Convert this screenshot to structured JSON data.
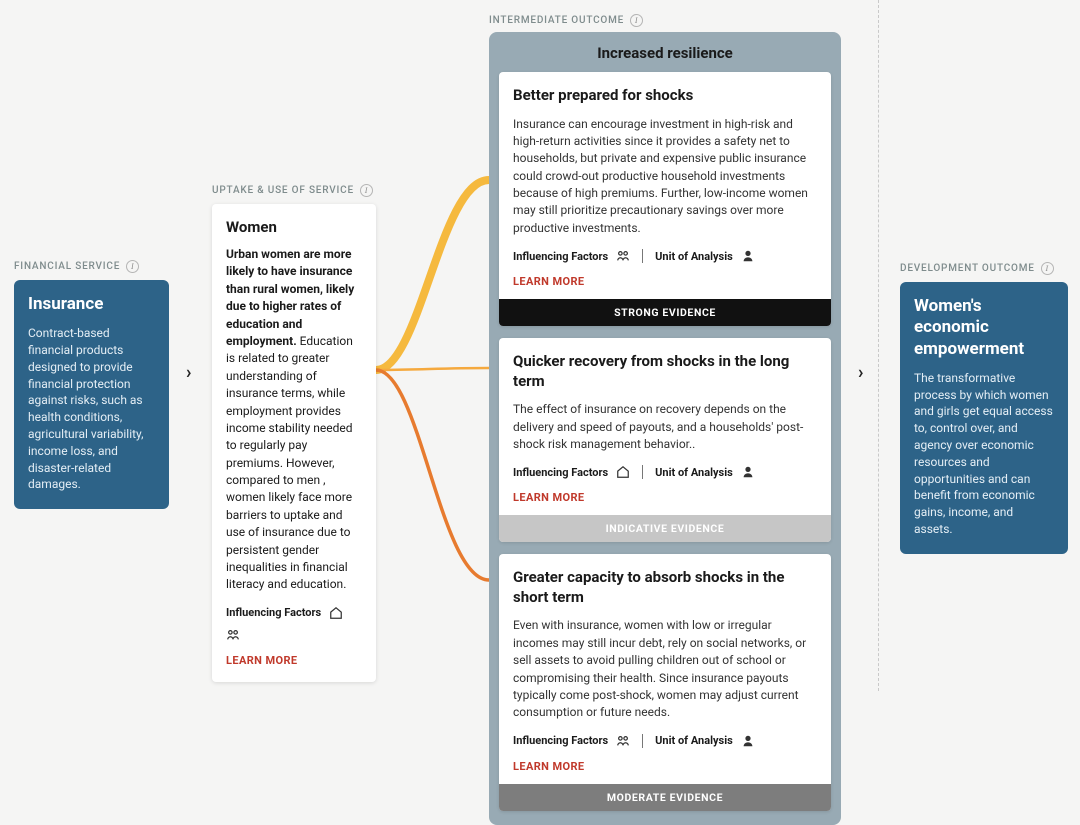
{
  "sections": {
    "financial_service": "FINANCIAL SERVICE",
    "uptake": "UPTAKE & USE OF SERVICE",
    "intermediate": "INTERMEDIATE OUTCOME",
    "development": "DEVELOPMENT OUTCOME"
  },
  "financial": {
    "title": "Insurance",
    "body": "Contract-based financial products designed to provide financial protection against risks, such as health conditions, agricultural variability, income loss, and disaster-related damages."
  },
  "uptake": {
    "title": "Women",
    "bold": "Urban women are more likely to have insurance than rural women, likely due to higher rates of education and employment.",
    "body": " Education is related to greater understanding of insurance terms, while employment provides income stability needed to regularly pay premiums. However, compared to men , women likely face more barriers to uptake and use of insurance due to persistent gender inequalities in financial literacy and education.",
    "influencing": "Influencing Factors",
    "learn_more": "LEARN MORE"
  },
  "intermediate_header": "Increased resilience",
  "outcomes": [
    {
      "title": "Better prepared for shocks",
      "body": "Insurance can encourage investment in high-risk and high-return activities since it provides a safety net to households, but private and expensive public insurance could crowd-out productive household investments because of high premiums. Further, low-income women may still prioritize precautionary savings over more productive investments.",
      "influencing": "Influencing Factors",
      "unit": "Unit of Analysis",
      "learn_more": "LEARN MORE",
      "evidence": "STRONG EVIDENCE",
      "evidence_class": "ev-strong"
    },
    {
      "title": "Quicker recovery from shocks in the long term",
      "body": "The effect of insurance on recovery depends on the delivery and speed of payouts, and a households' post-shock risk management behavior..",
      "influencing": "Influencing Factors",
      "unit": "Unit of Analysis",
      "learn_more": "LEARN MORE",
      "evidence": "INDICATIVE EVIDENCE",
      "evidence_class": "ev-indicative"
    },
    {
      "title": "Greater capacity to absorb shocks in the short term",
      "body": "Even with insurance, women with low or irregular incomes may still incur debt, rely on social networks, or sell assets to avoid pulling children out of school or compromising their health. Since insurance payouts typically come post-shock, women may adjust current consumption or future needs.",
      "influencing": "Influencing Factors",
      "unit": "Unit of Analysis",
      "learn_more": "LEARN MORE",
      "evidence": "MODERATE EVIDENCE",
      "evidence_class": "ev-moderate"
    }
  ],
  "development": {
    "title": "Women's economic empowerment",
    "body": "The transformative process by which women and girls get equal access to, control over, and agency over economic resources and opportunities and can benefit from economic gains, income, and assets."
  },
  "colors": {
    "connector1": "#f5b93e",
    "connector2": "#f5a93e",
    "connector3": "#e77b2f"
  }
}
